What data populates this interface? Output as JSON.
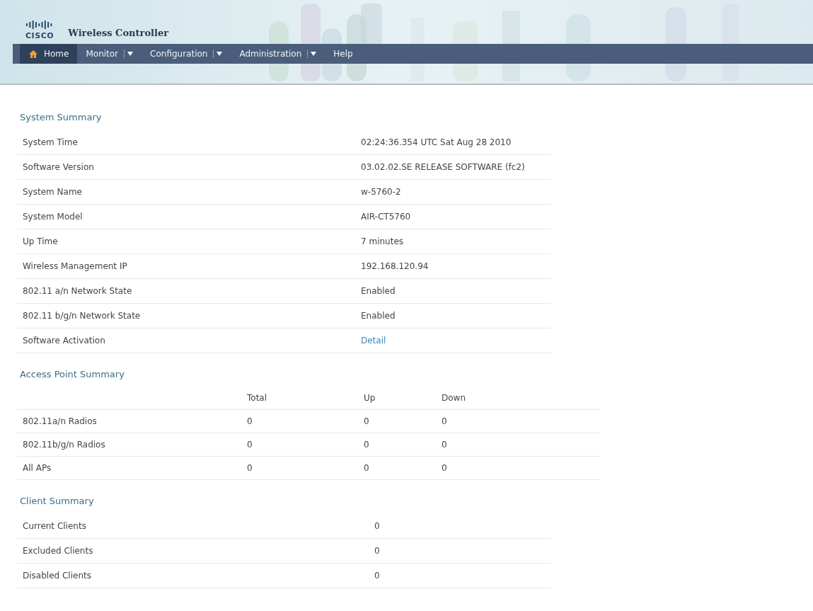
{
  "header": {
    "logo": "CISCO",
    "title": "Wireless Controller"
  },
  "nav": [
    {
      "label": "Home",
      "kind": "home",
      "selected": true
    },
    {
      "label": "Monitor",
      "kind": "menu",
      "selected": false
    },
    {
      "label": "Configuration",
      "kind": "menu",
      "selected": false
    },
    {
      "label": "Administration",
      "kind": "menu",
      "selected": false
    },
    {
      "label": "Help",
      "kind": "link",
      "selected": false
    }
  ],
  "system_summary": {
    "title": "System Summary",
    "rows": [
      {
        "label": "System Time",
        "value": "02:24:36.354 UTC Sat Aug 28 2010"
      },
      {
        "label": "Software Version",
        "value": "03.02.02.SE RELEASE SOFTWARE (fc2)"
      },
      {
        "label": "System Name",
        "value": "w-5760-2"
      },
      {
        "label": "System Model",
        "value": "AIR-CT5760"
      },
      {
        "label": "Up Time",
        "value": "7 minutes"
      },
      {
        "label": "Wireless Management IP",
        "value": "192.168.120.94"
      },
      {
        "label": "802.11 a/n Network State",
        "value": "Enabled"
      },
      {
        "label": "802.11 b/g/n Network State",
        "value": "Enabled"
      },
      {
        "label": "Software Activation",
        "value": "Detail",
        "kind": "link"
      }
    ]
  },
  "access_point_summary": {
    "title": "Access Point Summary",
    "columns": [
      "Total",
      "Up",
      "Down"
    ],
    "rows": [
      {
        "label": "802.11a/n Radios",
        "cells": [
          "0",
          "0",
          "0"
        ]
      },
      {
        "label": "802.11b/g/n Radios",
        "cells": [
          "0",
          "0",
          "0"
        ]
      },
      {
        "label": "All APs",
        "cells": [
          "0",
          "0",
          "0"
        ]
      }
    ]
  },
  "client_summary": {
    "title": "Client Summary",
    "rows": [
      {
        "label": "Current Clients",
        "value": "0"
      },
      {
        "label": "Excluded Clients",
        "value": "0"
      },
      {
        "label": "Disabled Clients",
        "value": "0"
      }
    ]
  }
}
